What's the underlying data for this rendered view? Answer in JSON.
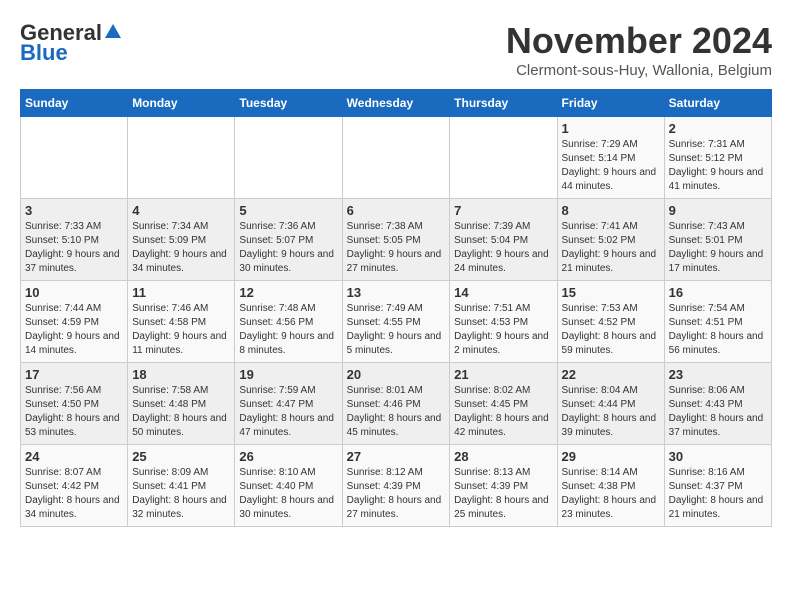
{
  "logo": {
    "general": "General",
    "blue": "Blue"
  },
  "title": "November 2024",
  "subtitle": "Clermont-sous-Huy, Wallonia, Belgium",
  "days_header": [
    "Sunday",
    "Monday",
    "Tuesday",
    "Wednesday",
    "Thursday",
    "Friday",
    "Saturday"
  ],
  "weeks": [
    [
      {
        "day": "",
        "sunrise": "",
        "sunset": "",
        "daylight": ""
      },
      {
        "day": "",
        "sunrise": "",
        "sunset": "",
        "daylight": ""
      },
      {
        "day": "",
        "sunrise": "",
        "sunset": "",
        "daylight": ""
      },
      {
        "day": "",
        "sunrise": "",
        "sunset": "",
        "daylight": ""
      },
      {
        "day": "",
        "sunrise": "",
        "sunset": "",
        "daylight": ""
      },
      {
        "day": "1",
        "sunrise": "Sunrise: 7:29 AM",
        "sunset": "Sunset: 5:14 PM",
        "daylight": "Daylight: 9 hours and 44 minutes."
      },
      {
        "day": "2",
        "sunrise": "Sunrise: 7:31 AM",
        "sunset": "Sunset: 5:12 PM",
        "daylight": "Daylight: 9 hours and 41 minutes."
      }
    ],
    [
      {
        "day": "3",
        "sunrise": "Sunrise: 7:33 AM",
        "sunset": "Sunset: 5:10 PM",
        "daylight": "Daylight: 9 hours and 37 minutes."
      },
      {
        "day": "4",
        "sunrise": "Sunrise: 7:34 AM",
        "sunset": "Sunset: 5:09 PM",
        "daylight": "Daylight: 9 hours and 34 minutes."
      },
      {
        "day": "5",
        "sunrise": "Sunrise: 7:36 AM",
        "sunset": "Sunset: 5:07 PM",
        "daylight": "Daylight: 9 hours and 30 minutes."
      },
      {
        "day": "6",
        "sunrise": "Sunrise: 7:38 AM",
        "sunset": "Sunset: 5:05 PM",
        "daylight": "Daylight: 9 hours and 27 minutes."
      },
      {
        "day": "7",
        "sunrise": "Sunrise: 7:39 AM",
        "sunset": "Sunset: 5:04 PM",
        "daylight": "Daylight: 9 hours and 24 minutes."
      },
      {
        "day": "8",
        "sunrise": "Sunrise: 7:41 AM",
        "sunset": "Sunset: 5:02 PM",
        "daylight": "Daylight: 9 hours and 21 minutes."
      },
      {
        "day": "9",
        "sunrise": "Sunrise: 7:43 AM",
        "sunset": "Sunset: 5:01 PM",
        "daylight": "Daylight: 9 hours and 17 minutes."
      }
    ],
    [
      {
        "day": "10",
        "sunrise": "Sunrise: 7:44 AM",
        "sunset": "Sunset: 4:59 PM",
        "daylight": "Daylight: 9 hours and 14 minutes."
      },
      {
        "day": "11",
        "sunrise": "Sunrise: 7:46 AM",
        "sunset": "Sunset: 4:58 PM",
        "daylight": "Daylight: 9 hours and 11 minutes."
      },
      {
        "day": "12",
        "sunrise": "Sunrise: 7:48 AM",
        "sunset": "Sunset: 4:56 PM",
        "daylight": "Daylight: 9 hours and 8 minutes."
      },
      {
        "day": "13",
        "sunrise": "Sunrise: 7:49 AM",
        "sunset": "Sunset: 4:55 PM",
        "daylight": "Daylight: 9 hours and 5 minutes."
      },
      {
        "day": "14",
        "sunrise": "Sunrise: 7:51 AM",
        "sunset": "Sunset: 4:53 PM",
        "daylight": "Daylight: 9 hours and 2 minutes."
      },
      {
        "day": "15",
        "sunrise": "Sunrise: 7:53 AM",
        "sunset": "Sunset: 4:52 PM",
        "daylight": "Daylight: 8 hours and 59 minutes."
      },
      {
        "day": "16",
        "sunrise": "Sunrise: 7:54 AM",
        "sunset": "Sunset: 4:51 PM",
        "daylight": "Daylight: 8 hours and 56 minutes."
      }
    ],
    [
      {
        "day": "17",
        "sunrise": "Sunrise: 7:56 AM",
        "sunset": "Sunset: 4:50 PM",
        "daylight": "Daylight: 8 hours and 53 minutes."
      },
      {
        "day": "18",
        "sunrise": "Sunrise: 7:58 AM",
        "sunset": "Sunset: 4:48 PM",
        "daylight": "Daylight: 8 hours and 50 minutes."
      },
      {
        "day": "19",
        "sunrise": "Sunrise: 7:59 AM",
        "sunset": "Sunset: 4:47 PM",
        "daylight": "Daylight: 8 hours and 47 minutes."
      },
      {
        "day": "20",
        "sunrise": "Sunrise: 8:01 AM",
        "sunset": "Sunset: 4:46 PM",
        "daylight": "Daylight: 8 hours and 45 minutes."
      },
      {
        "day": "21",
        "sunrise": "Sunrise: 8:02 AM",
        "sunset": "Sunset: 4:45 PM",
        "daylight": "Daylight: 8 hours and 42 minutes."
      },
      {
        "day": "22",
        "sunrise": "Sunrise: 8:04 AM",
        "sunset": "Sunset: 4:44 PM",
        "daylight": "Daylight: 8 hours and 39 minutes."
      },
      {
        "day": "23",
        "sunrise": "Sunrise: 8:06 AM",
        "sunset": "Sunset: 4:43 PM",
        "daylight": "Daylight: 8 hours and 37 minutes."
      }
    ],
    [
      {
        "day": "24",
        "sunrise": "Sunrise: 8:07 AM",
        "sunset": "Sunset: 4:42 PM",
        "daylight": "Daylight: 8 hours and 34 minutes."
      },
      {
        "day": "25",
        "sunrise": "Sunrise: 8:09 AM",
        "sunset": "Sunset: 4:41 PM",
        "daylight": "Daylight: 8 hours and 32 minutes."
      },
      {
        "day": "26",
        "sunrise": "Sunrise: 8:10 AM",
        "sunset": "Sunset: 4:40 PM",
        "daylight": "Daylight: 8 hours and 30 minutes."
      },
      {
        "day": "27",
        "sunrise": "Sunrise: 8:12 AM",
        "sunset": "Sunset: 4:39 PM",
        "daylight": "Daylight: 8 hours and 27 minutes."
      },
      {
        "day": "28",
        "sunrise": "Sunrise: 8:13 AM",
        "sunset": "Sunset: 4:39 PM",
        "daylight": "Daylight: 8 hours and 25 minutes."
      },
      {
        "day": "29",
        "sunrise": "Sunrise: 8:14 AM",
        "sunset": "Sunset: 4:38 PM",
        "daylight": "Daylight: 8 hours and 23 minutes."
      },
      {
        "day": "30",
        "sunrise": "Sunrise: 8:16 AM",
        "sunset": "Sunset: 4:37 PM",
        "daylight": "Daylight: 8 hours and 21 minutes."
      }
    ]
  ]
}
